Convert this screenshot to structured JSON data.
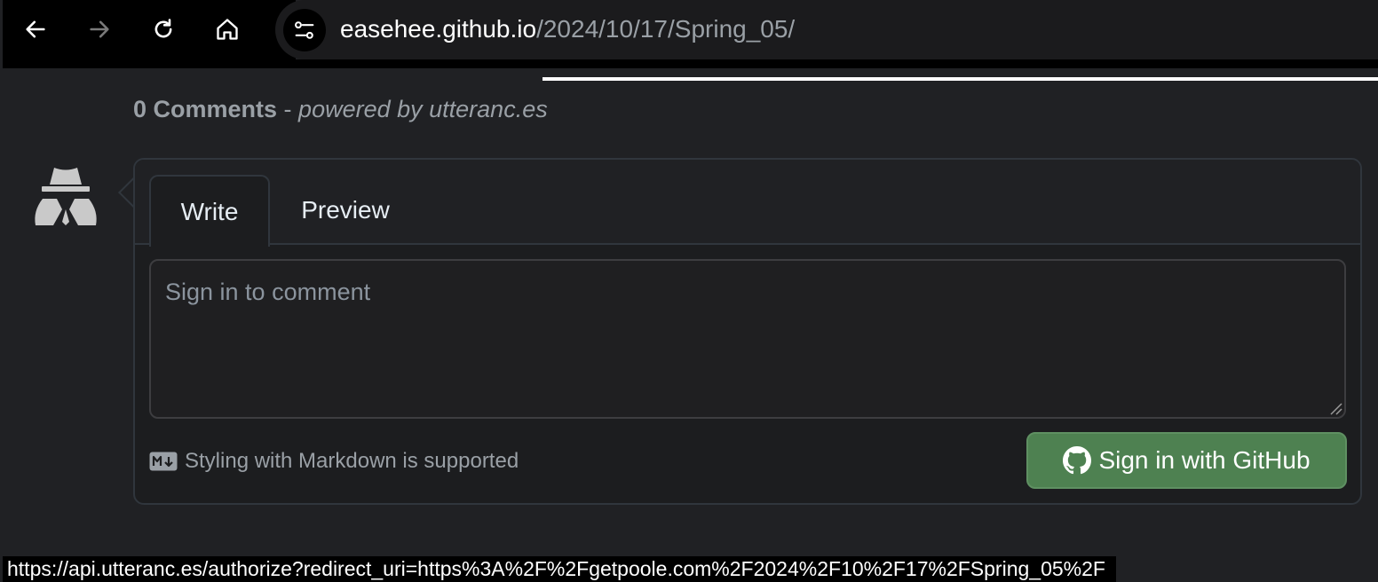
{
  "browser": {
    "back_icon": "arrow-left-icon",
    "forward_icon": "arrow-right-icon",
    "reload_icon": "reload-icon",
    "home_icon": "home-icon",
    "site_info_icon": "tune-icon",
    "url_host": "easehee.github.io",
    "url_path": "/2024/10/17/Spring_05/"
  },
  "comments": {
    "count_text": "0 Comments",
    "separator": " - ",
    "powered_text": "powered by utteranc.es"
  },
  "avatar_icon": "anonymous-user-icon",
  "editor": {
    "tabs": [
      {
        "label": "Write",
        "active": true
      },
      {
        "label": "Preview",
        "active": false
      }
    ],
    "placeholder": "Sign in to comment",
    "markdown_icon": "markdown-icon",
    "markdown_note": "Styling with Markdown is supported",
    "signin_icon": "github-icon",
    "signin_label": "Sign in with GitHub"
  },
  "status_bar": {
    "url": "https://api.utteranc.es/authorize?redirect_uri=https%3A%2F%2Fgetpoole.com%2F2024%2F10%2F17%2FSpring_05%2F"
  },
  "colors": {
    "background": "#202124",
    "signin_button": "#4e8151",
    "border": "#30363d"
  }
}
